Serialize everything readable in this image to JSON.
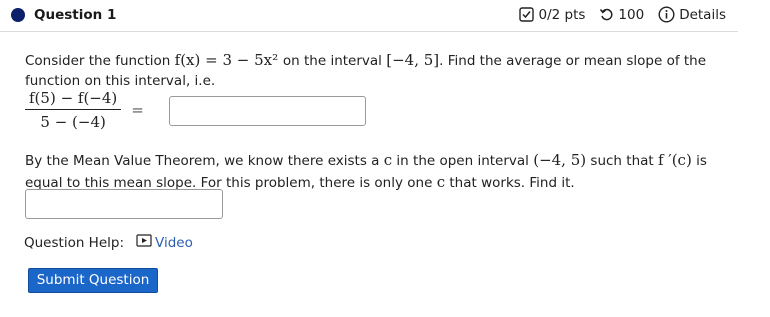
{
  "question": {
    "title": "Question 1"
  },
  "meta": {
    "points": "0/2 pts",
    "retries": "100",
    "details": "Details"
  },
  "content": {
    "p1_a": "Consider the function ",
    "p1_func": "f(x) = 3 − 5x² ",
    "p1_b": "on the interval ",
    "p1_interval": "[−4, 5]",
    "p1_c": ". Find the average or mean slope of the function on this interval, i.e.",
    "frac_num": "f(5) − f(−4)",
    "frac_den": "5 − (−4)",
    "eq": "=",
    "p2_a": "By the Mean Value Theorem, we know there exists a ",
    "p2_c1": "c",
    "p2_b": " in the open interval ",
    "p2_interval": "(−4, 5)",
    "p2_c": " such that ",
    "p2_fprime": "f ′(c)",
    "p2_d": " is equal to this mean slope. For this problem, there is only one ",
    "p2_c2": "c",
    "p2_e": " that works. Find it."
  },
  "help": {
    "label": "Question Help:",
    "video": "Video"
  },
  "submit": {
    "label": "Submit Question"
  },
  "colors": {
    "accent": "#1b66c9",
    "dot": "#0c1f6b",
    "link": "#2d5fb1"
  },
  "icons": [
    "checkbox-icon",
    "retry-icon",
    "info-icon",
    "video-icon"
  ]
}
